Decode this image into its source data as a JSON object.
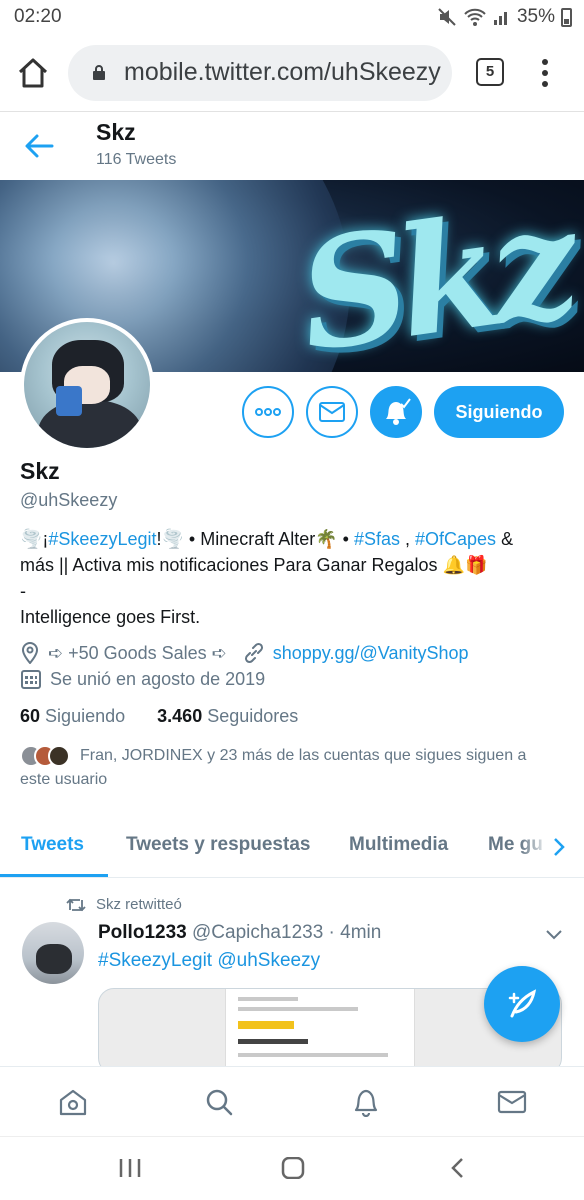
{
  "status_bar": {
    "time": "02:20",
    "battery": "35%"
  },
  "browser": {
    "url": "mobile.twitter.com/uhSkeezy",
    "tab_count": "5"
  },
  "header": {
    "name": "Skz",
    "tweet_count": "116 Tweets"
  },
  "profile": {
    "name": "Skz",
    "handle": "@uhSkeezy",
    "follow_label": "Siguiendo",
    "bio": {
      "l1_a": "🌪️¡",
      "l1_tag1": "#SkeezyLegit",
      "l1_b": "!🌪️ • Minecraft Alter🌴 • ",
      "l1_tag2": "#Sfas",
      "l1_c": " , ",
      "l1_tag3": "#OfCapes",
      "l1_d": " &",
      "l2": "más || Activa mis notificaciones Para Ganar Regalos 🔔🎁",
      "l3": "-",
      "l4": "Intelligence goes First."
    },
    "location": "➪ +50 Goods Sales ➪",
    "website": "shoppy.gg/@VanityShop",
    "joined": "Se unió en agosto de 2019",
    "following_count": "60",
    "following_label": "Siguiendo",
    "followers_count": "3.460",
    "followers_label": "Seguidores",
    "followed_by_line1": "Fran, JORDINEX y 23 más de las cuentas que sigues siguen a",
    "followed_by_line2": "este usuario"
  },
  "tabs": [
    {
      "label": "Tweets"
    },
    {
      "label": "Tweets y respuestas"
    },
    {
      "label": "Multimedia"
    },
    {
      "label": "Me gu"
    }
  ],
  "tweet": {
    "retweet_label": "Skz retwitteó",
    "author_name": "Pollo1233",
    "author_handle": "@Capicha1233",
    "separator": "·",
    "time": "4min",
    "text": "#SkeezyLegit @uhSkeezy"
  },
  "colors": {
    "accent": "#1da1f2",
    "link": "#1b95e0",
    "muted": "#657786"
  }
}
